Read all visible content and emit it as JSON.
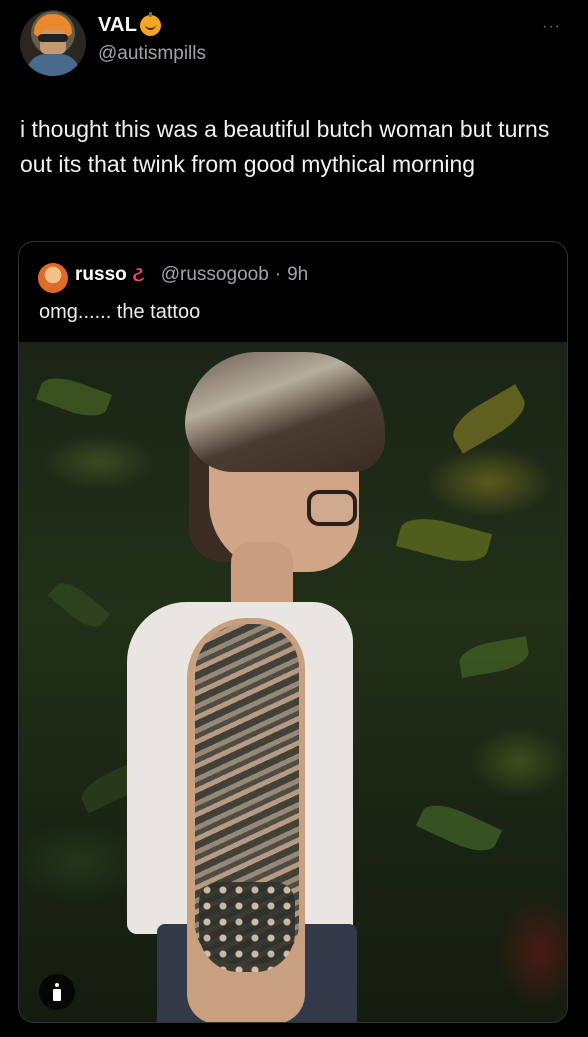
{
  "tweet": {
    "author": {
      "display_name": "VAL",
      "handle": "@autismpills",
      "name_emoji_icon": "pumpkin-icon",
      "avatar": "avatar"
    },
    "more_icon": "···",
    "text": "i thought this was a beautiful butch woman but turns out its that twink from good mythical morning"
  },
  "quoted_tweet": {
    "author": {
      "display_name": "russo",
      "handle": "@russogoob",
      "separator": "·",
      "time": "9h",
      "name_emoji_icon": "worm-icon",
      "worm_glyph": "ટ"
    },
    "text": "omg...... the tattoo",
    "photo": {
      "description_icon": "person-icon"
    }
  },
  "colors": {
    "background": "#000000",
    "text": "#e7e9ea",
    "muted": "#a0a4a8",
    "border": "#2f3336"
  }
}
